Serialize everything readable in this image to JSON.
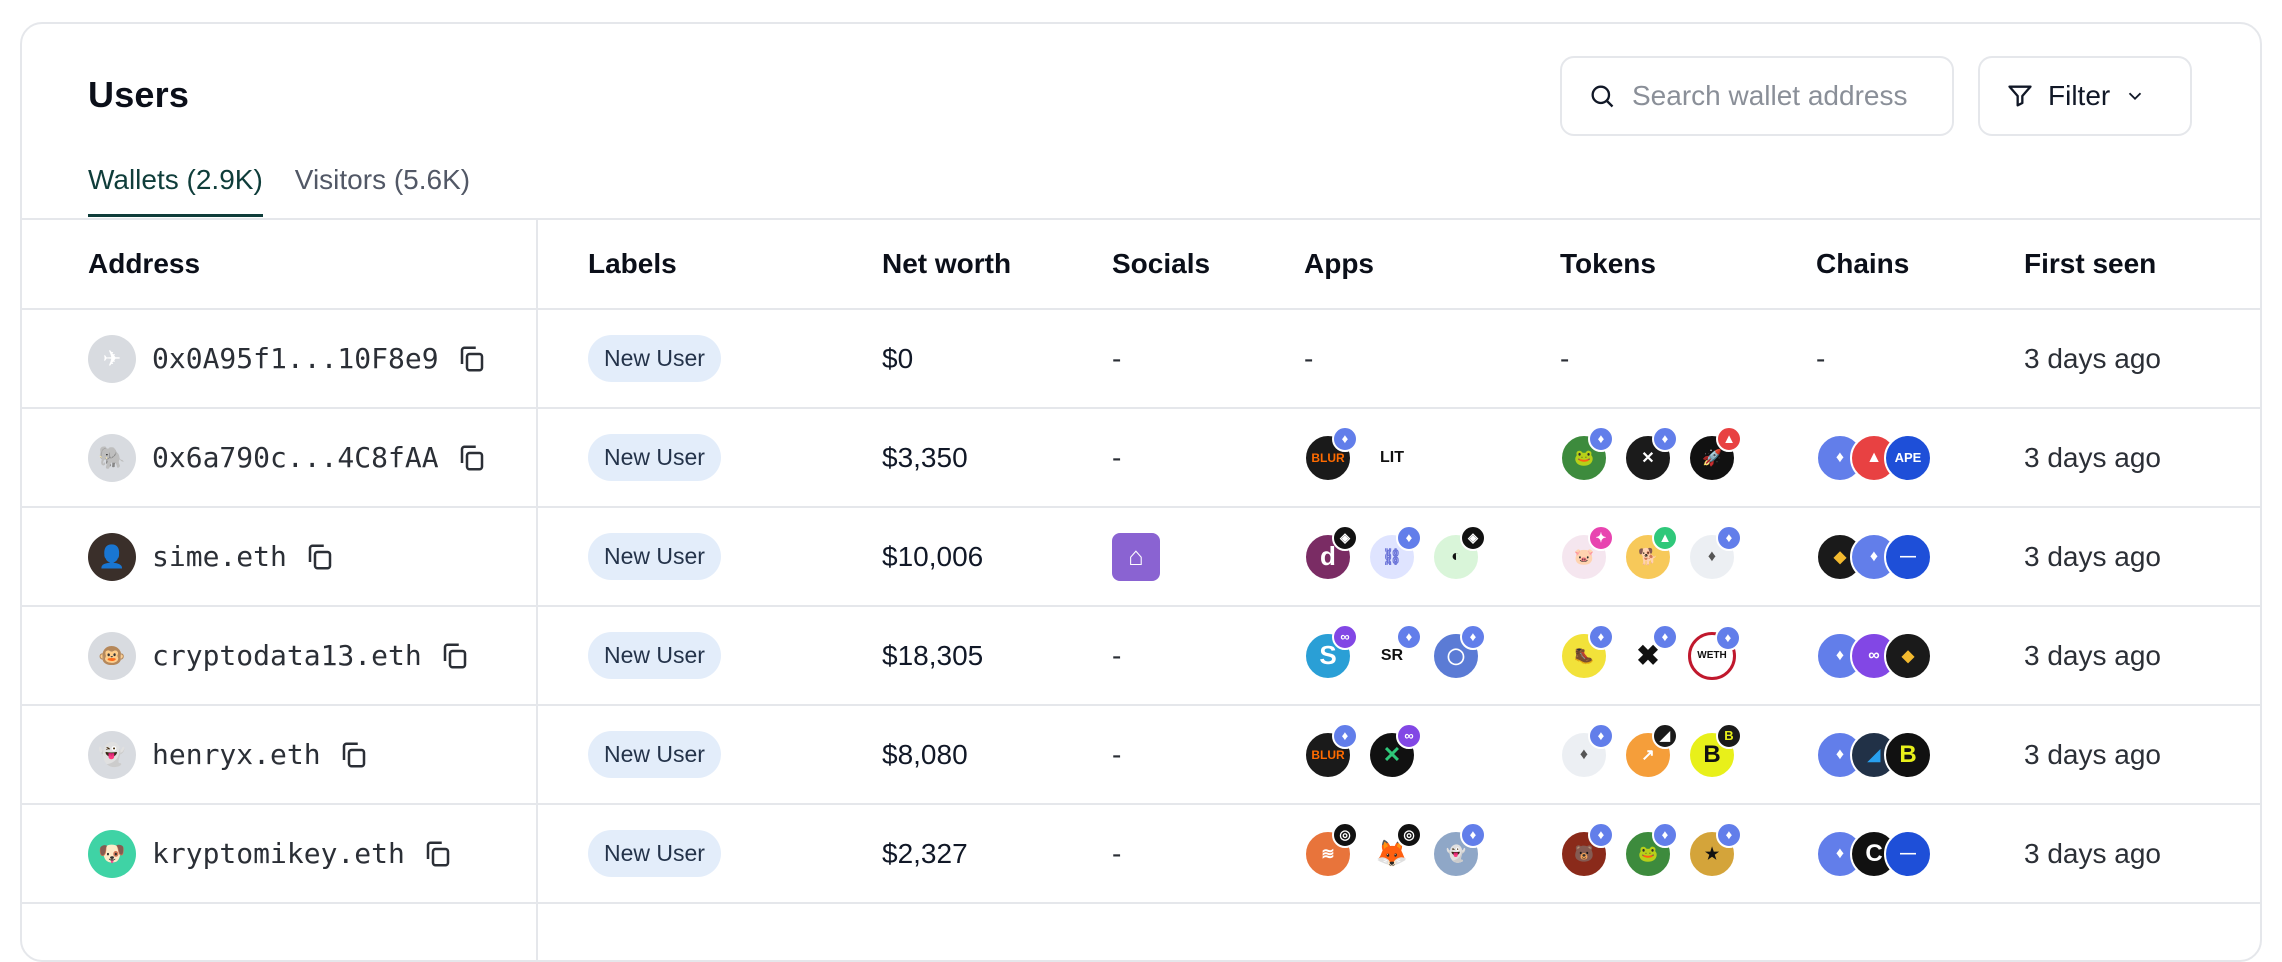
{
  "header": {
    "title": "Users"
  },
  "search": {
    "placeholder": "Search wallet address"
  },
  "filter": {
    "label": "Filter"
  },
  "tabs": [
    {
      "label": "Wallets (2.9K)",
      "active": true
    },
    {
      "label": "Visitors (5.6K)",
      "active": false
    }
  ],
  "columns": [
    "Address",
    "Labels",
    "Net worth",
    "Socials",
    "Apps",
    "Tokens",
    "Chains",
    "First seen"
  ],
  "rows": [
    {
      "address": "0x0A95f1...10F8e9",
      "label": "New User",
      "net_worth": "$0",
      "socials": "-",
      "apps": "-",
      "tokens": "-",
      "chains": "-",
      "first_seen": "3 days ago"
    },
    {
      "address": "0x6a790c...4C8fAA",
      "label": "New User",
      "net_worth": "$3,350",
      "socials": "-",
      "first_seen": "3 days ago"
    },
    {
      "address": "sime.eth",
      "label": "New User",
      "net_worth": "$10,006",
      "first_seen": "3 days ago"
    },
    {
      "address": "cryptodata13.eth",
      "label": "New User",
      "net_worth": "$18,305",
      "socials": "-",
      "first_seen": "3 days ago"
    },
    {
      "address": "henryx.eth",
      "label": "New User",
      "net_worth": "$8,080",
      "socials": "-",
      "first_seen": "3 days ago"
    },
    {
      "address": "kryptomikey.eth",
      "label": "New User",
      "net_worth": "$2,327",
      "socials": "-",
      "first_seen": "3 days ago"
    }
  ],
  "icon_text": {
    "lit": "LIT",
    "sr": "SR",
    "ape": "APE",
    "blur": "BLUR",
    "weth": "WETH"
  },
  "colors": {
    "accent": "#0f3d3a",
    "badge_bg": "#e3edfa",
    "border": "#e5e7eb",
    "eth": "#627eea",
    "farcaster": "#8a63d2"
  }
}
